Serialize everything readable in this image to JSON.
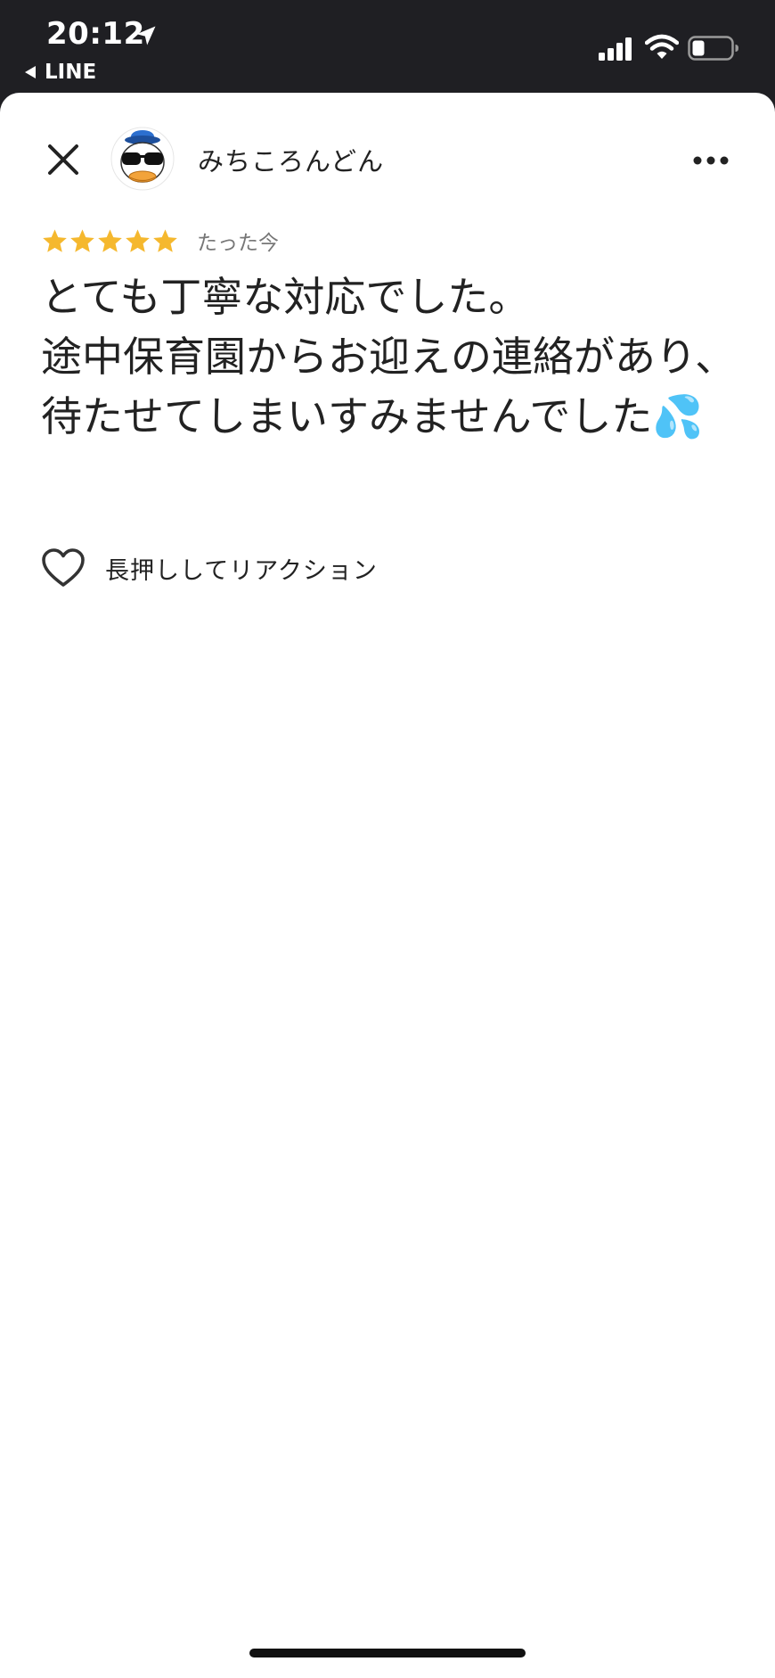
{
  "status_bar": {
    "time": "20:12",
    "back_app": "LINE",
    "icons": [
      "location-arrow-icon",
      "cellular-signal-icon",
      "wifi-icon",
      "battery-icon"
    ]
  },
  "header": {
    "author_name": "みちころんどん",
    "icons": [
      "close-icon",
      "more-icon"
    ]
  },
  "review": {
    "rating": 5,
    "rating_max": 5,
    "star_color": "#F5B82E",
    "timestamp": "たった今",
    "text": "とても丁寧な対応でした。\n途中保育園からお迎えの連絡があり、待たせてしまいすみませんでした💦"
  },
  "reaction": {
    "label": "長押ししてリアクション",
    "icon": "heart-icon"
  },
  "colors": {
    "status_bar_bg": "#1F1F23",
    "sheet_bg": "#FFFFFF",
    "text": "#222222",
    "muted_text": "#777777"
  }
}
